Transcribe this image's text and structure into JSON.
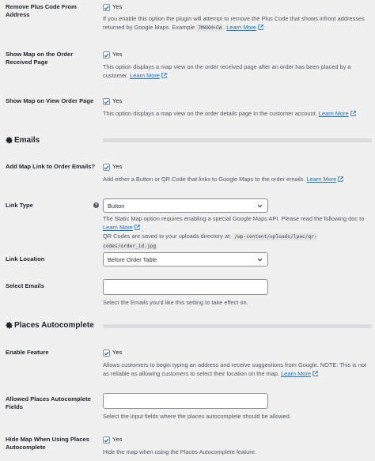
{
  "plus_code": {
    "label": "Remove Plus Code From Address",
    "checkbox_label": "Yes",
    "desc_before": "If you enable this option the plugin will attempt to remove the Plus Code that shows infront addresses returned by Google Maps. Example",
    "example_code": "7M4XH+CW",
    "learn_more": "Learn More"
  },
  "map_order_received": {
    "label": "Show Map on the Order Received Page",
    "checkbox_label": "Yes",
    "desc": "This option displays a map view on the order received page after an order has been placed by a customer.",
    "learn_more": "Learn More"
  },
  "map_view_order": {
    "label": "Show Map on View Order Page",
    "checkbox_label": "Yes",
    "desc": "This option displays a map view on the order details page in the customer account.",
    "learn_more": "Learn More"
  },
  "emails_section": {
    "title": "Emails"
  },
  "add_map_link": {
    "label": "Add Map Link to Order Emails?",
    "checkbox_label": "Yes",
    "desc": "Add either a Button or QR Code that links to Google Maps to the order emails.",
    "learn_more": "Learn More"
  },
  "link_type": {
    "label": "Link Type",
    "help_glyph": "?",
    "selected": "Button",
    "desc_line1": "The Static Map option requires enabling a special Google Maps API. Please read the following doc to",
    "learn_more": "Learn More",
    "desc_line3": "QR Codes are saved to your uploads directory at:",
    "path_code": "/wp-content/uploads/lpac/qr-codes/order_id.jpg"
  },
  "link_location": {
    "label": "Link Location",
    "selected": "Before Order Table"
  },
  "select_emails": {
    "label": "Select Emails",
    "placeholder": "",
    "desc": "Select the Emails you'd like this setting to take effect on."
  },
  "places_section": {
    "title": "Places Autocomplete"
  },
  "enable_feature": {
    "label": "Enable Feature",
    "checkbox_label": "Yes",
    "desc": "Allows customers to begin typing an address and receive suggestions from Google. NOTE: This is not as reliable as allowing customers to select their location on the map.",
    "learn_more": "Learn More"
  },
  "allowed_fields": {
    "label": "Allowed Places Autocomplete Fields",
    "placeholder": "",
    "desc": "Select the input fields where the places autocomplete should be allowed."
  },
  "hide_map": {
    "label": "Hide Map When Using Places Autocomplete",
    "checkbox_label": "Yes",
    "desc": "Hide the map when using the Places Autocomplete feature."
  },
  "colors": {
    "link": "#2271b1",
    "check": "#2271b1"
  }
}
